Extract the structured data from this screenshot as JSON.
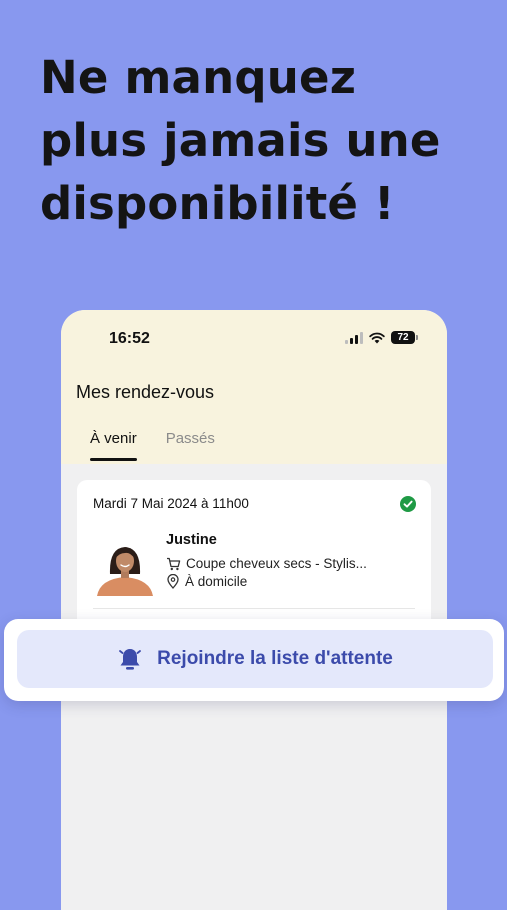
{
  "headline": {
    "line1": "Ne manquez",
    "line2": "plus jamais une",
    "line3": "disponibilité !"
  },
  "status_bar": {
    "time": "16:52",
    "battery": "72"
  },
  "page": {
    "title": "Mes rendez-vous",
    "tabs": [
      {
        "label": "À venir",
        "active": true
      },
      {
        "label": "Passés",
        "active": false
      }
    ]
  },
  "appointment": {
    "date": "Mardi 7 Mai 2024 à 11h00",
    "name": "Justine",
    "service": "Coupe cheveux secs - Stylis...",
    "location": "À domicile",
    "status_icon": "check-circle-icon"
  },
  "waitlist": {
    "label": "Rejoindre la liste d'attente",
    "icon": "bell-icon"
  },
  "colors": {
    "background": "#8898ef",
    "phone_header": "#f8f3de",
    "accent": "#3c4bab",
    "button_bg": "#e4e8fb",
    "success": "#1f9a45"
  }
}
